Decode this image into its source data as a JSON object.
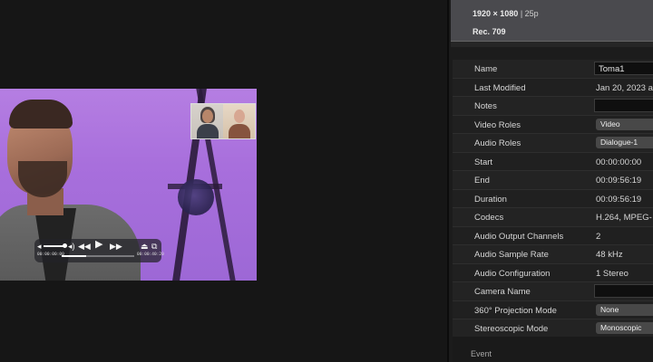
{
  "viewer": {
    "playback": {
      "current_time": "00:00:00:00",
      "duration": "00:00:40:20",
      "progress": 0.34,
      "volume": 0.82
    }
  },
  "inspector": {
    "header": {
      "resolution": "1920 × 1080",
      "frame_rate": "25p",
      "color_space": "Rec. 709"
    },
    "properties": [
      {
        "label": "Name",
        "value": "Toma1",
        "kind": "field"
      },
      {
        "label": "Last Modified",
        "value": "Jan 20, 2023 a",
        "kind": "text"
      },
      {
        "label": "Notes",
        "value": "",
        "kind": "field"
      },
      {
        "label": "Video Roles",
        "value": "Video",
        "kind": "popup"
      },
      {
        "label": "Audio Roles",
        "value": "Dialogue-1",
        "kind": "popup"
      },
      {
        "label": "Start",
        "value": "00:00:00:00",
        "kind": "text"
      },
      {
        "label": "End",
        "value": "00:09:56:19",
        "kind": "text"
      },
      {
        "label": "Duration",
        "value": "00:09:56:19",
        "kind": "text"
      },
      {
        "label": "Codecs",
        "value": "H.264, MPEG-",
        "kind": "text"
      },
      {
        "label": "Audio Output Channels",
        "value": "2",
        "kind": "text"
      },
      {
        "label": "Audio Sample Rate",
        "value": "48 kHz",
        "kind": "text"
      },
      {
        "label": "Audio Configuration",
        "value": "1 Stereo",
        "kind": "text"
      },
      {
        "label": "Camera Name",
        "value": "",
        "kind": "field"
      },
      {
        "label": "360° Projection Mode",
        "value": "None",
        "kind": "popup"
      },
      {
        "label": "Stereoscopic Mode",
        "value": "Monoscopic",
        "kind": "popup"
      }
    ],
    "section": {
      "label": "Event"
    }
  },
  "colors": {
    "background": "#161616",
    "inspector_bg": "#1c1c1c",
    "header_bg": "#4a4a4e",
    "video_backdrop": "#a86fdc",
    "popup_bg": "#484848"
  }
}
